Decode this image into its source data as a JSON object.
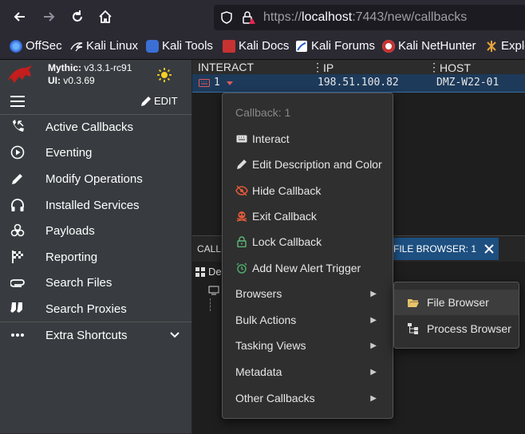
{
  "browser": {
    "url_scheme": "https://",
    "url_host": "localhost",
    "url_rest": ":7443/new/callbacks",
    "bookmarks": [
      {
        "label": "OffSec",
        "icon": "offsec-icon"
      },
      {
        "label": "Kali Linux",
        "icon": "kali-dragon-icon"
      },
      {
        "label": "Kali Tools",
        "icon": "kali-tools-icon"
      },
      {
        "label": "Kali Docs",
        "icon": "kali-docs-icon"
      },
      {
        "label": "Kali Forums",
        "icon": "kali-forums-icon"
      },
      {
        "label": "Kali NetHunter",
        "icon": "nethunter-icon"
      },
      {
        "label": "Exple",
        "icon": "exploit-db-icon"
      }
    ]
  },
  "app": {
    "mythic_label": "Mythic:",
    "mythic_version": "v3.3.1-rc91",
    "ui_label": "UI:",
    "ui_version": "v0.3.69",
    "edit_label": "EDIT",
    "nav": [
      {
        "label": "Active Callbacks",
        "icon": "phone-callback-icon"
      },
      {
        "label": "Eventing",
        "icon": "play-circle-icon"
      },
      {
        "label": "Modify Operations",
        "icon": "pencil-icon"
      },
      {
        "label": "Installed Services",
        "icon": "headphones-icon"
      },
      {
        "label": "Payloads",
        "icon": "biohazard-icon"
      },
      {
        "label": "Reporting",
        "icon": "checkered-flag-icon"
      },
      {
        "label": "Search Files",
        "icon": "paperclip-icon"
      },
      {
        "label": "Search Proxies",
        "icon": "socks-icon"
      }
    ],
    "extra_shortcuts": "Extra Shortcuts"
  },
  "table": {
    "headers": [
      "INTERACT",
      "IP",
      "HOST"
    ],
    "row": {
      "id": "1",
      "ip": "198.51.100.82",
      "host": "DMZ-W22-01"
    }
  },
  "lower": {
    "tab_left": "CALL",
    "tab_active": "FILE BROWSER: 1",
    "tree_label": "De"
  },
  "context_menu": {
    "header": "Callback: 1",
    "items": [
      {
        "label": "Interact",
        "icon": "keyboard-icon"
      },
      {
        "label": "Edit Description and Color",
        "icon": "pencil-icon"
      },
      {
        "label": "Hide Callback",
        "icon": "eye-off-icon"
      },
      {
        "label": "Exit Callback",
        "icon": "skull-icon"
      },
      {
        "label": "Lock Callback",
        "icon": "lock-icon"
      },
      {
        "label": "Add New Alert Trigger",
        "icon": "alarm-icon"
      }
    ],
    "submenus": [
      "Browsers",
      "Bulk Actions",
      "Tasking Views",
      "Metadata",
      "Other Callbacks"
    ]
  },
  "browsers_submenu": {
    "items": [
      {
        "label": "File Browser",
        "icon": "folder-open-icon"
      },
      {
        "label": "Process Browser",
        "icon": "process-tree-icon"
      }
    ]
  },
  "colors": {
    "accent": "#1d4f80",
    "logo_red": "#c41e1e",
    "danger_icon": "#e05a3a",
    "lock_icon": "#5fb878",
    "alarm_icon": "#4ea96a"
  }
}
